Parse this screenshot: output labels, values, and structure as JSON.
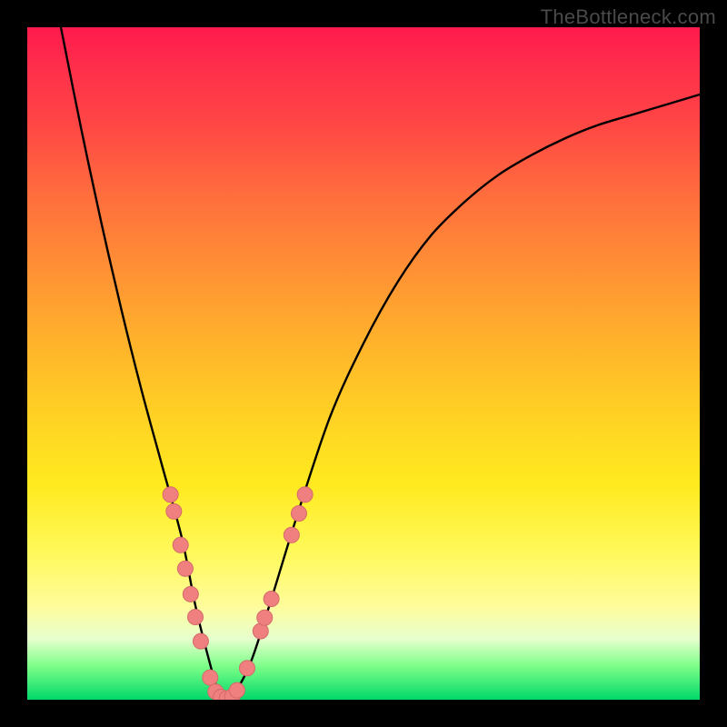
{
  "watermark": "TheBottleneck.com",
  "colors": {
    "frame": "#000000",
    "curve": "#000000",
    "dot_fill": "#f08080",
    "dot_stroke": "#d46a6a",
    "gradient_top": "#ff1a4d",
    "gradient_bottom": "#00d86a"
  },
  "chart_data": {
    "type": "line",
    "title": "",
    "xlabel": "",
    "ylabel": "",
    "xlim": [
      0,
      100
    ],
    "ylim": [
      0,
      100
    ],
    "grid": false,
    "legend": false,
    "series": [
      {
        "name": "bottleneck-curve",
        "x": [
          5,
          8,
          11,
          14,
          17,
          20,
          23,
          25,
          27,
          28.5,
          30,
          33,
          36,
          40,
          45,
          50,
          55,
          60,
          65,
          70,
          75,
          80,
          85,
          90,
          95,
          100
        ],
        "y": [
          100,
          85,
          71,
          58,
          46,
          35,
          24,
          14,
          6,
          1,
          0,
          5,
          14,
          27,
          42,
          53,
          62,
          69,
          74,
          78,
          81,
          83.5,
          85.5,
          87,
          88.5,
          90
        ]
      }
    ],
    "markers": [
      {
        "x": 21.3,
        "y": 30.5
      },
      {
        "x": 21.8,
        "y": 28.0
      },
      {
        "x": 22.8,
        "y": 23.0
      },
      {
        "x": 23.5,
        "y": 19.5
      },
      {
        "x": 24.3,
        "y": 15.7
      },
      {
        "x": 25.0,
        "y": 12.3
      },
      {
        "x": 25.8,
        "y": 8.7
      },
      {
        "x": 27.2,
        "y": 3.3
      },
      {
        "x": 28.0,
        "y": 1.2
      },
      {
        "x": 28.8,
        "y": 0.4
      },
      {
        "x": 29.7,
        "y": 0.2
      },
      {
        "x": 30.5,
        "y": 0.5
      },
      {
        "x": 31.2,
        "y": 1.4
      },
      {
        "x": 32.7,
        "y": 4.7
      },
      {
        "x": 34.7,
        "y": 10.2
      },
      {
        "x": 35.3,
        "y": 12.2
      },
      {
        "x": 36.3,
        "y": 15.0
      },
      {
        "x": 39.3,
        "y": 24.5
      },
      {
        "x": 40.4,
        "y": 27.7
      },
      {
        "x": 41.3,
        "y": 30.5
      }
    ]
  }
}
